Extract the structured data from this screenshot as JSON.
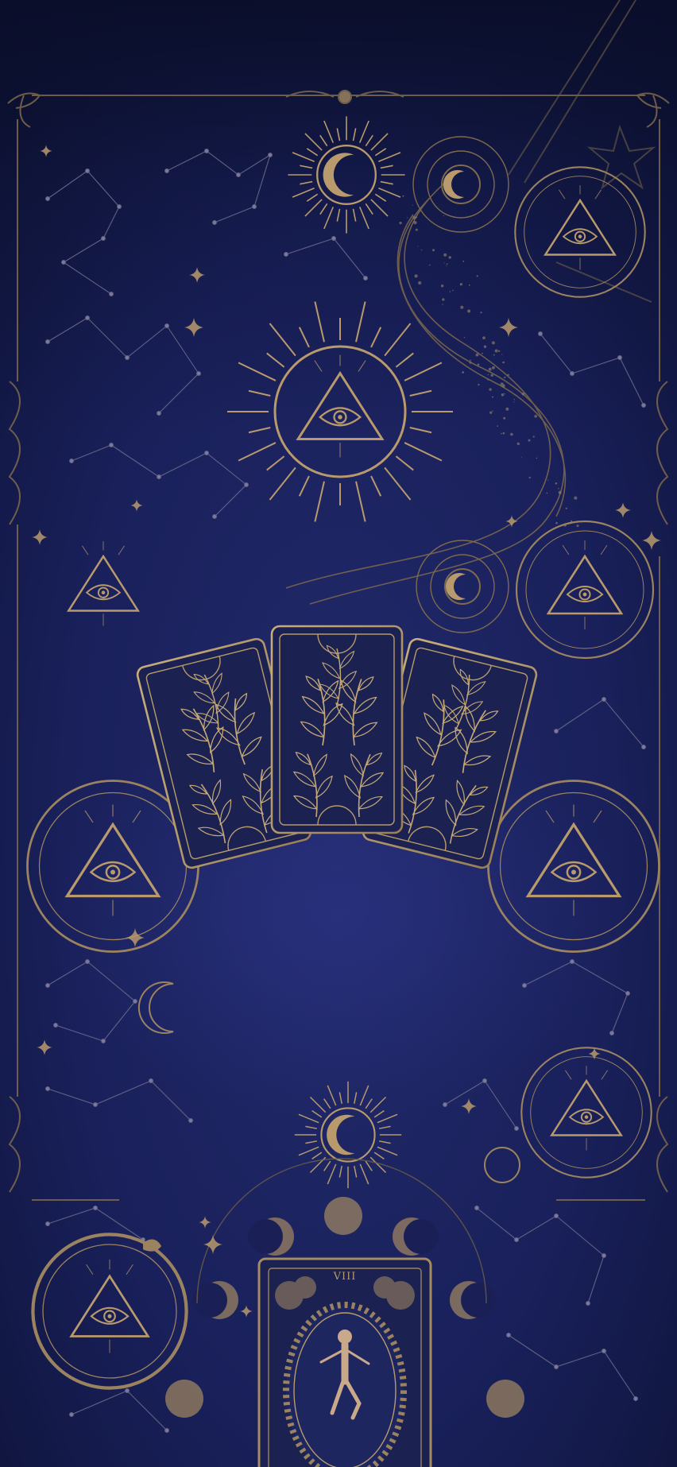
{
  "image": {
    "kind": "wallpaper-illustration",
    "theme": "celestial tarot",
    "colors": {
      "background_top": "#10163a",
      "background_mid": "#1d2463",
      "background_bottom": "#141a48",
      "gold": "#b89a6c",
      "gold_dim": "#7e6a4e",
      "card_fill": "#1a1f4c",
      "figure_skin": "#c9a98a"
    },
    "card_numeral": "VIII",
    "icons": [
      "all-seeing-eye-triangle-icon",
      "crescent-moon-sun-icon",
      "tarot-card-back-icon",
      "constellation-icon",
      "sparkle-star-icon",
      "moon-phases-icon",
      "ouroboros-icon"
    ]
  }
}
